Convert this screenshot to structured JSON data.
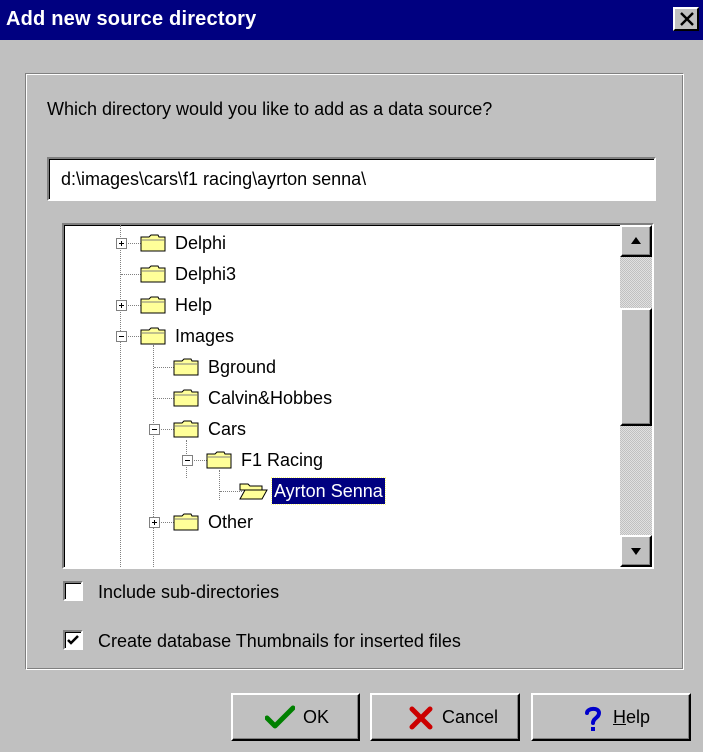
{
  "window": {
    "title": "Add new source directory",
    "close_glyph": "×"
  },
  "dialog": {
    "question": "Which directory would you like to add as a data source?",
    "path_value": "d:\\images\\cars\\f1 racing\\ayrton senna\\"
  },
  "tree": {
    "items": [
      {
        "label": "Delphi",
        "level": 0,
        "expander": "plus",
        "open": false,
        "selected": false
      },
      {
        "label": "Delphi3",
        "level": 0,
        "expander": "none",
        "open": false,
        "selected": false
      },
      {
        "label": "Help",
        "level": 0,
        "expander": "plus",
        "open": false,
        "selected": false
      },
      {
        "label": "Images",
        "level": 0,
        "expander": "minus",
        "open": false,
        "selected": false
      },
      {
        "label": "Bground",
        "level": 1,
        "expander": "none",
        "open": false,
        "selected": false
      },
      {
        "label": "Calvin&Hobbes",
        "level": 1,
        "expander": "none",
        "open": false,
        "selected": false
      },
      {
        "label": "Cars",
        "level": 1,
        "expander": "minus",
        "open": false,
        "selected": false
      },
      {
        "label": "F1 Racing",
        "level": 2,
        "expander": "minus",
        "open": false,
        "selected": false
      },
      {
        "label": "Ayrton Senna",
        "level": 3,
        "expander": "none",
        "open": true,
        "selected": true
      },
      {
        "label": "Other",
        "level": 1,
        "expander": "plus",
        "open": false,
        "selected": false
      }
    ]
  },
  "options": {
    "include_subdirs_label": "Include sub-directories",
    "include_subdirs_checked": false,
    "create_thumbnails_label": "Create database Thumbnails for inserted files",
    "create_thumbnails_checked": true
  },
  "buttons": {
    "ok_label": "OK",
    "cancel_label": "Cancel",
    "help_mnemonic": "H",
    "help_rest": "elp"
  },
  "colors": {
    "titlebar": "#000080",
    "face": "#c0c0c0",
    "selection": "#000080",
    "folder": "#ffff99",
    "ok_check": "#008000",
    "cancel_x": "#cc0000",
    "help_mark": "#0000cc"
  },
  "icons": {
    "close": "close-icon",
    "folder": "folder-icon",
    "open_folder": "folder-open-icon",
    "scroll_up": "arrow-up-icon",
    "scroll_down": "arrow-down-icon",
    "ok": "checkmark-icon",
    "cancel": "x-icon",
    "help": "question-mark-icon"
  }
}
